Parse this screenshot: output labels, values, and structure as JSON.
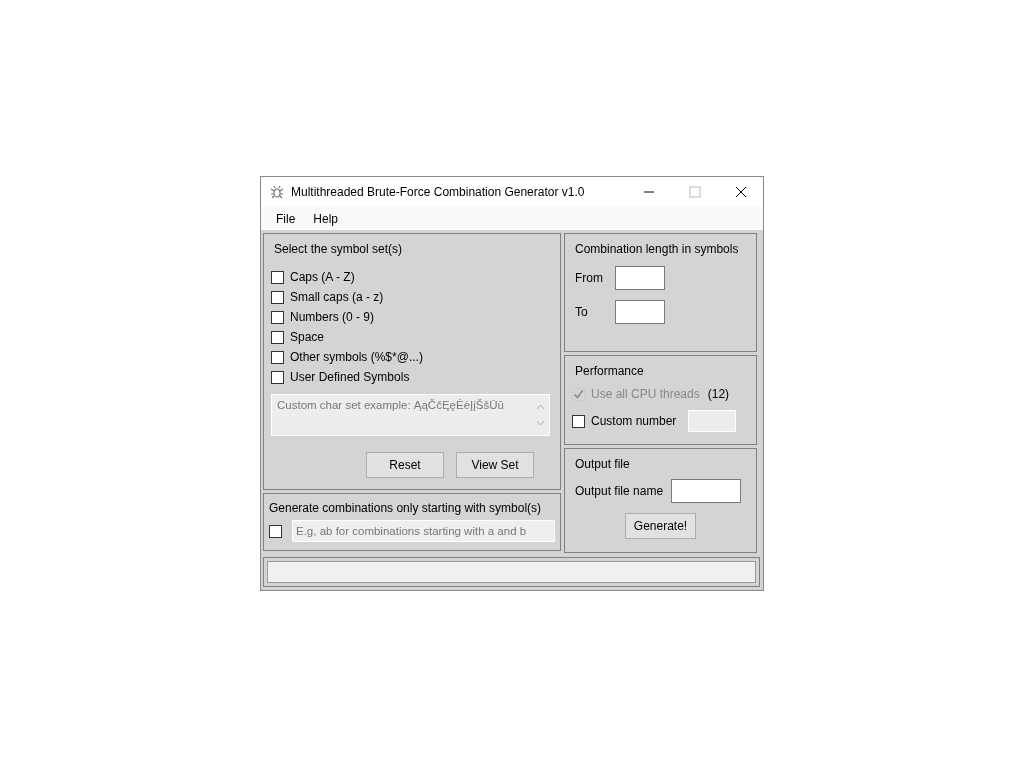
{
  "window": {
    "title": "Multithreaded Brute-Force Combination Generator v1.0"
  },
  "menu": [
    "File",
    "Help"
  ],
  "symbol_set": {
    "title": "Select the symbol set(s)",
    "options": [
      {
        "label": "Caps (A - Z)",
        "checked": false
      },
      {
        "label": "Small caps (a - z)",
        "checked": false
      },
      {
        "label": "Numbers (0 - 9)",
        "checked": false
      },
      {
        "label": "Space",
        "checked": false
      },
      {
        "label": "Other symbols (%$*@...)",
        "checked": false
      },
      {
        "label": "User Defined Symbols",
        "checked": false
      }
    ],
    "custom_field": {
      "placeholder": "Custom char set example: ĄąČčĘęĖėĮįŠšŪū"
    },
    "buttons": [
      "Reset",
      "View Set"
    ]
  },
  "prefix": {
    "title": "Generate combinations only starting with symbol(s)",
    "checked": false,
    "placeholder": "E.g, ab for combinations starting with a and b"
  },
  "length": {
    "title": "Combination length in symbols",
    "from_label": "From",
    "to_label": "To"
  },
  "performance": {
    "title": "Performance",
    "use_all": {
      "label": "Use all CPU threads",
      "count": "(12)",
      "checked": true,
      "disabled": true
    },
    "custom": {
      "label": "Custom number",
      "checked": false
    }
  },
  "output": {
    "title": "Output file",
    "name_label": "Output file name",
    "button": "Generate!"
  },
  "progress": {
    "level": 0
  }
}
